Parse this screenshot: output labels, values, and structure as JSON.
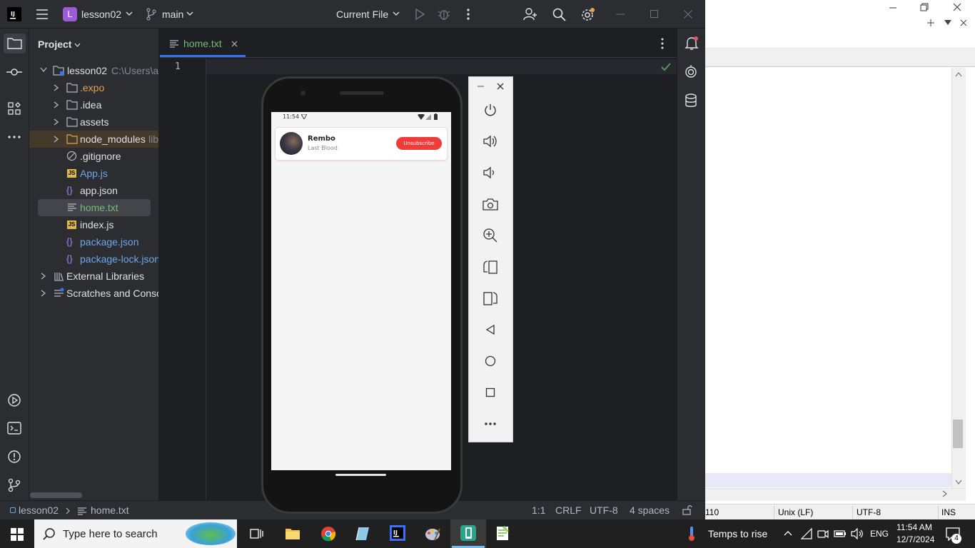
{
  "ide": {
    "project_name": "lesson02",
    "project_initial": "L",
    "branch": "main",
    "run_config": "Current File",
    "panel_title": "Project",
    "tree": [
      {
        "label": "lesson02",
        "suffix": "C:\\Users\\a",
        "type": "root"
      },
      {
        "label": ".expo",
        "type": "folder"
      },
      {
        "label": ".idea",
        "type": "folder"
      },
      {
        "label": "assets",
        "type": "folder"
      },
      {
        "label": "node_modules",
        "suffix": "lib",
        "type": "folder-excluded"
      },
      {
        "label": ".gitignore",
        "type": "ignore"
      },
      {
        "label": "App.js",
        "type": "js"
      },
      {
        "label": "app.json",
        "type": "json"
      },
      {
        "label": "home.txt",
        "type": "txt"
      },
      {
        "label": "index.js",
        "type": "js"
      },
      {
        "label": "package.json",
        "type": "json"
      },
      {
        "label": "package-lock.json",
        "type": "json"
      },
      {
        "label": "External Libraries",
        "type": "lib"
      },
      {
        "label": "Scratches and Consoles",
        "type": "scratch"
      }
    ],
    "tab_label": "home.txt",
    "line_number": "1",
    "status": {
      "breadcrumb_project": "lesson02",
      "breadcrumb_file": "home.txt",
      "position": "1:1",
      "line_sep": "CRLF",
      "encoding": "UTF-8",
      "indent": "4 spaces"
    },
    "colors": {
      "accent": "#3574f0",
      "modified": "#e0a35c",
      "new": "#6fa8e8",
      "selected": "#57965c"
    }
  },
  "phone": {
    "time": "11:54",
    "card_title": "Rembo",
    "card_subtitle": "Last Blood",
    "button_label": "Unsubscribe",
    "button_color": "#f03b3b"
  },
  "notepad": {
    "status_pos": "110",
    "status_eol": "Unix (LF)",
    "status_enc": "UTF-8",
    "status_mode": "INS"
  },
  "taskbar": {
    "search_placeholder": "Type here to search",
    "weather": "Temps to rise",
    "lang": "ENG",
    "time": "11:54 AM",
    "date": "12/7/2024",
    "notif_count": "4"
  }
}
